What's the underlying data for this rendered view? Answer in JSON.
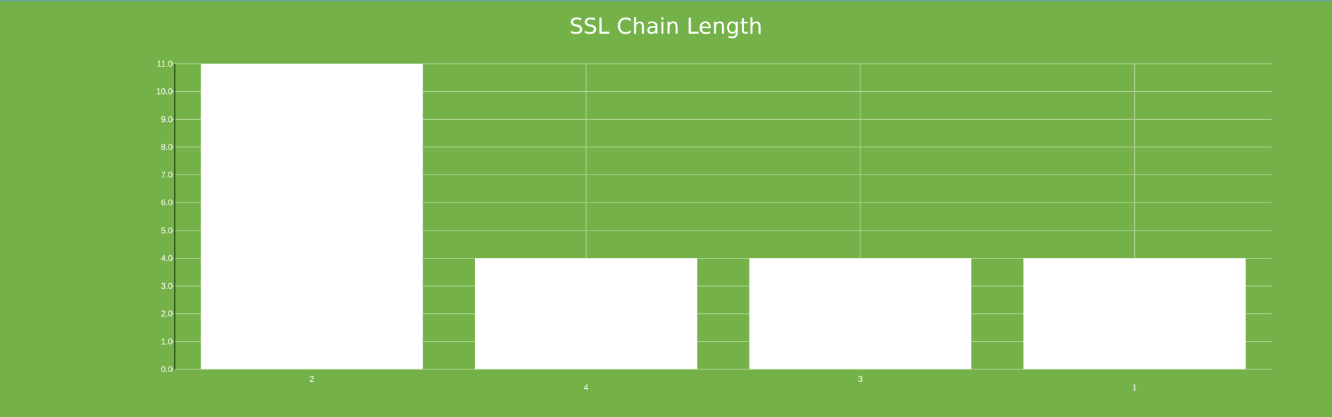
{
  "title": "SSL Chain Length",
  "colors": {
    "background": "#74b249",
    "bar": "#ffffff",
    "grid": "#b9d89e",
    "axis": "#1f3d10",
    "text": "#ffffff"
  },
  "chart_data": {
    "type": "bar",
    "title": "SSL Chain Length",
    "categories": [
      "2",
      "4",
      "3",
      "1"
    ],
    "values": [
      11,
      4,
      4,
      4
    ],
    "xlabel": "",
    "ylabel": "",
    "ylim": [
      0,
      11
    ],
    "yticks": [
      "0.0",
      "1.0",
      "2.0",
      "3.0",
      "4.0",
      "5.0",
      "6.0",
      "7.0",
      "8.0",
      "9.0",
      "10.0",
      "11.0"
    ],
    "grid": true,
    "legend": "none"
  }
}
